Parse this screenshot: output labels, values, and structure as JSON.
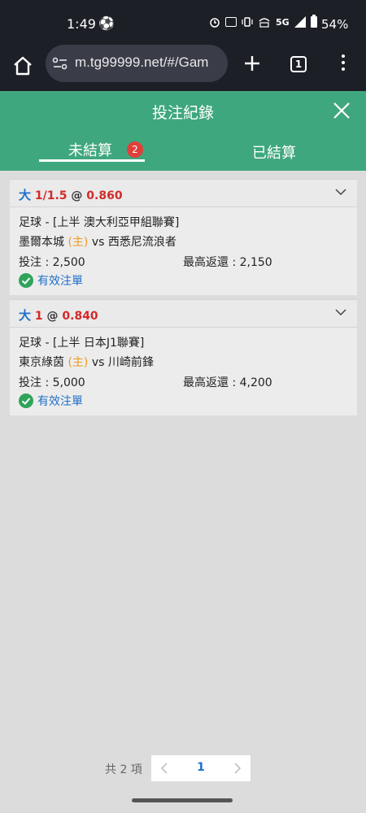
{
  "status_bar": {
    "time": "1:49",
    "network": "5G",
    "battery": "54%"
  },
  "browser": {
    "url": "m.tg99999.net/#/Gam",
    "tab_count": "1"
  },
  "header": {
    "title": "投注紀錄",
    "accent_color": "#3fa77e"
  },
  "tabs": {
    "pending_label": "未結算",
    "pending_count": "2",
    "settled_label": "已結算"
  },
  "bets": [
    {
      "side": "大",
      "line": "1/1.5",
      "at": "@",
      "odds": "0.860",
      "sport_league": "足球 - [上半 澳大利亞甲組聯賽]",
      "home_team": "墨爾本城",
      "home_tag": "(主)",
      "vs": "vs",
      "away_team": "西悉尼流浪者",
      "stake_label": "投注 : 2,500",
      "max_return_label": "最高返還 : 2,150",
      "status": "有效注單"
    },
    {
      "side": "大",
      "line": "1",
      "at": "@",
      "odds": "0.840",
      "sport_league": "足球 - [上半 日本J1聯賽]",
      "home_team": "東京綠茵",
      "home_tag": "(主)",
      "vs": "vs",
      "away_team": "川崎前鋒",
      "stake_label": "投注 : 5,000",
      "max_return_label": "最高返還 : 4,200",
      "status": "有效注單"
    }
  ],
  "pagination": {
    "total_label": "共 2 項",
    "current_page": "1"
  }
}
